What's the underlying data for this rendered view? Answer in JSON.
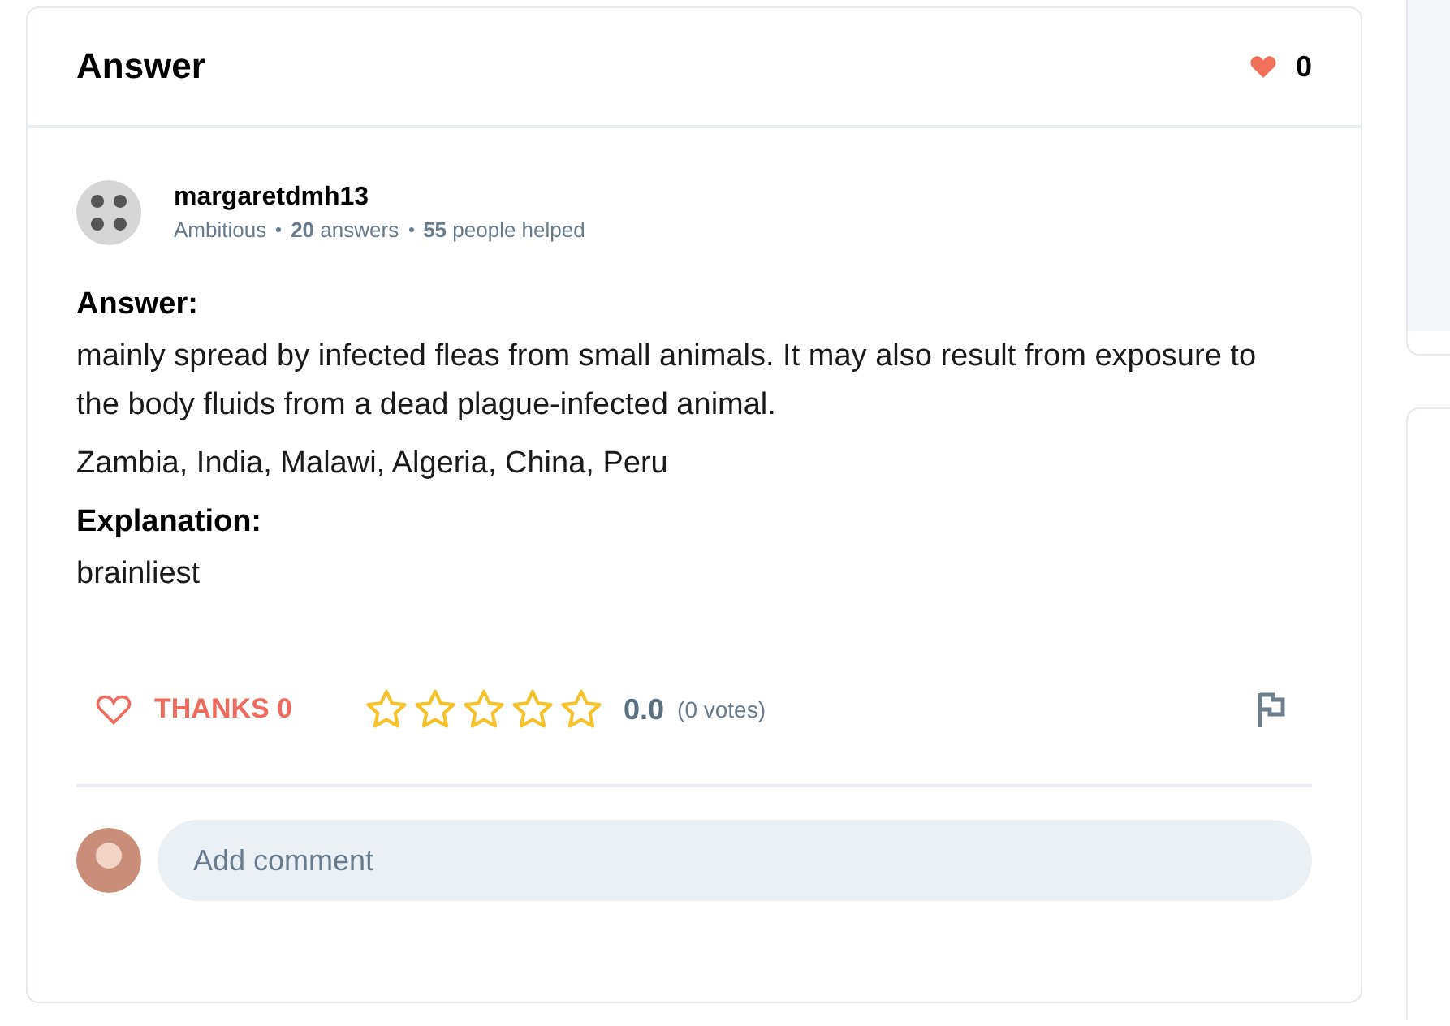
{
  "answer_card": {
    "title": "Answer",
    "likes": "0",
    "author": {
      "name": "margaretdmh13",
      "rank": "Ambitious",
      "answers_count": "20",
      "answers_label": "answers",
      "helped_count": "55",
      "helped_label": "people helped"
    },
    "content": [
      {
        "kind": "heading",
        "text": "Answer:"
      },
      {
        "kind": "text",
        "text": "mainly spread by infected fleas from small animals. It may also result from exposure to the body fluids from a dead plague-infected animal."
      },
      {
        "kind": "text",
        "text": "Zambia, India, Malawi, Algeria, China, Peru"
      },
      {
        "kind": "heading",
        "text": "Explanation:"
      },
      {
        "kind": "text",
        "text": "brainliest"
      }
    ],
    "thanks": "THANKS 0",
    "stars": 0,
    "rating": "0.0",
    "votes": "(0 votes)",
    "comment": {
      "placeholder": "Add comment"
    }
  }
}
